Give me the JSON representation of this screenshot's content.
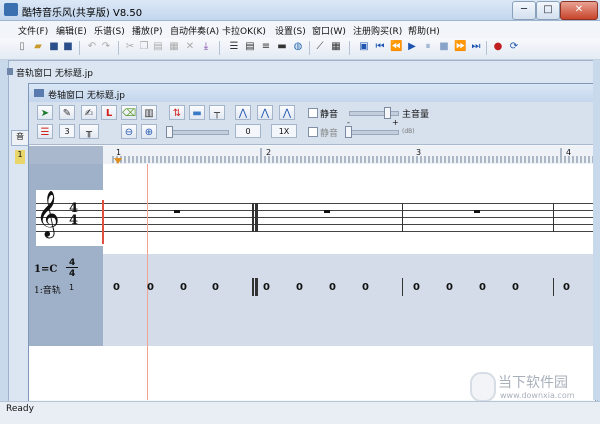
{
  "app": {
    "title": "酷特音乐风(共享版) V8.50"
  },
  "window_controls": {
    "minimize": "─",
    "maximize": "□",
    "close": "✕"
  },
  "menu": [
    "文件(F)",
    "编辑(E)",
    "乐谱(S)",
    "播放(P)",
    "自动伴奏(A)",
    "卡拉OK(K)",
    "设置(S)",
    "窗口(W)",
    "注册购买(R)",
    "帮助(H)"
  ],
  "track_window": {
    "title": "音轨窗口  无标题.jp",
    "side_tab": "音",
    "side_label": "1"
  },
  "score_window": {
    "title": "卷轴窗口  无标题.jp",
    "toolbar": {
      "red_l": "L",
      "step_value": "3",
      "zoom_value": "0",
      "speed_value": "1X",
      "mute_label_1": "静音",
      "mute_label_2": "静音",
      "master_volume_label": "主音量",
      "minus": "-",
      "plus": "+",
      "db_hint": "(dB)"
    }
  },
  "ruler": {
    "measures": [
      "1",
      "2",
      "3",
      "4"
    ]
  },
  "staff": {
    "time_top": "4",
    "time_bottom": "4",
    "clef": "𝄞"
  },
  "jianpu": {
    "key": "1=C",
    "time_top": "4",
    "time_bottom": "4",
    "track_label": "1:音轨",
    "track_num": "1",
    "notes": [
      "0",
      "0",
      "0",
      "0",
      "0",
      "0",
      "0",
      "0",
      "0",
      "0",
      "0",
      "0",
      "0"
    ]
  },
  "status": {
    "text": "Ready"
  },
  "watermark": {
    "line1": "当下软件园",
    "line2": "www.downxia.com"
  },
  "colors": {
    "accent": "#2a5aa8",
    "playhead": "#e06040"
  }
}
